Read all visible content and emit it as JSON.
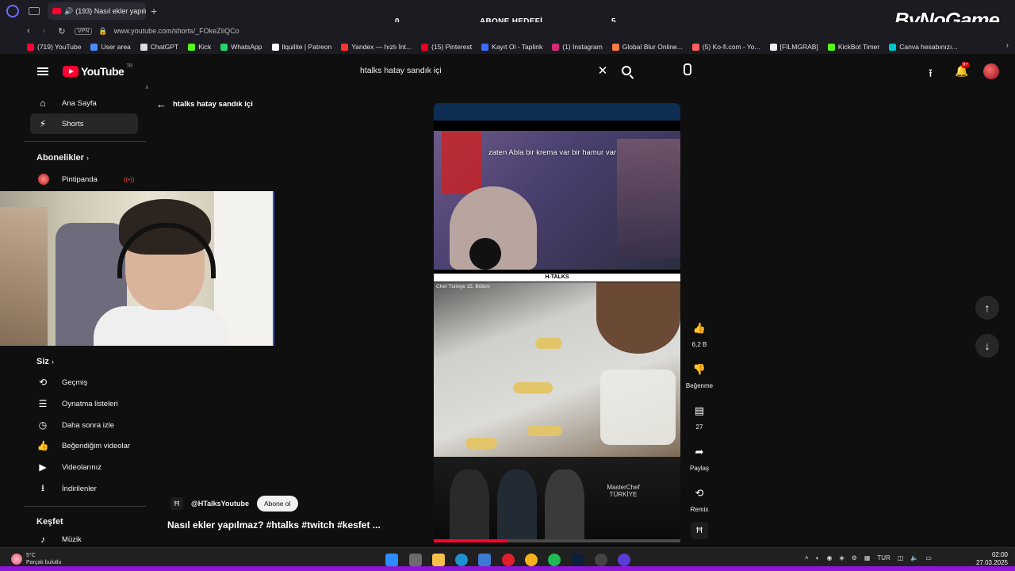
{
  "browser": {
    "tab_title": "(193) Nasıl ekler yapılm",
    "url": "www.youtube.com/shorts/_FOkeZIiQCo",
    "vpn_label": "VPN",
    "bookmarks": [
      {
        "label": "(719) YouTube",
        "color": "#ff0033"
      },
      {
        "label": "User area",
        "color": "#4a8cff"
      },
      {
        "label": "ChatGPT",
        "color": "#dddddd"
      },
      {
        "label": "Kick",
        "color": "#53fc18"
      },
      {
        "label": "WhatsApp",
        "color": "#25d366"
      },
      {
        "label": "llquilite | Patreon",
        "color": "#ffffff"
      },
      {
        "label": "Yandex — hızlı İnt...",
        "color": "#ff3333"
      },
      {
        "label": "(15) Pinterest",
        "color": "#e60023"
      },
      {
        "label": "Kayıt Ol - Taplink",
        "color": "#3c6cff"
      },
      {
        "label": "(1) Instagram",
        "color": "#d62976"
      },
      {
        "label": "Global Blur Online...",
        "color": "#ff7a45"
      },
      {
        "label": "(5) Ko-fi.com - Yo...",
        "color": "#ff5f5f"
      },
      {
        "label": "[FILMGRAB]",
        "color": "#eeeeee"
      },
      {
        "label": "KickBot Timer",
        "color": "#53fc18"
      },
      {
        "label": "Canva hesabınızı...",
        "color": "#00c4cc"
      }
    ]
  },
  "stream_overlay": {
    "goal_label": "ABONE HEDEFİ",
    "goal_current": "0",
    "goal_target": "5",
    "brand": "ByNoGame"
  },
  "youtube": {
    "logo_text": "YouTube",
    "region": "TR",
    "search_query": "htalks hatay sandık içi",
    "notifications_badge": "9+"
  },
  "sidebar": {
    "primary": [
      {
        "label": "Ana Sayfa",
        "icon": "home-icon"
      },
      {
        "label": "Shorts",
        "icon": "shorts-icon"
      }
    ],
    "subscriptions_header": "Abonelikler",
    "subscriptions": [
      {
        "label": "Pintipanda",
        "live": true
      }
    ],
    "you_header": "Siz",
    "you_items": [
      {
        "label": "Geçmiş",
        "icon": "history-icon"
      },
      {
        "label": "Oynatma listeleri",
        "icon": "playlist-icon"
      },
      {
        "label": "Daha sonra izle",
        "icon": "clock-icon"
      },
      {
        "label": "Beğendiğim videolar",
        "icon": "thumb-up-icon"
      },
      {
        "label": "Videolarınız",
        "icon": "video-icon"
      },
      {
        "label": "İndirilenler",
        "icon": "download-icon"
      }
    ],
    "explore_header": "Keşfet",
    "explore_items": [
      {
        "label": "Müzik",
        "icon": "music-icon"
      }
    ]
  },
  "shorts": {
    "back_label": "htalks hatay sandık içi",
    "caption": "zaten Abla bir krema var bir hamur var",
    "strip_text": "H-TALKS",
    "clip_tag": "Chef Türkiye 15. Bölüm",
    "masterchef_label": "MasterChef TÜRKİYE",
    "progress_pct": 30,
    "likes": "6,2 B",
    "dislike_label": "Beğenme",
    "comments": "27",
    "share_label": "Paylaş",
    "remix_label": "Remix",
    "channel_handle": "@HTalksYoutube",
    "subscribe_label": "Abone ol",
    "title": "Nasıl ekler yapılmaz? #htalks #twitch #kesfet ..."
  },
  "taskbar": {
    "weather_temp": "5°C",
    "weather_desc": "Parçalı bulutlu",
    "language": "TUR",
    "time": "02:00",
    "date": "27.03.2025"
  }
}
